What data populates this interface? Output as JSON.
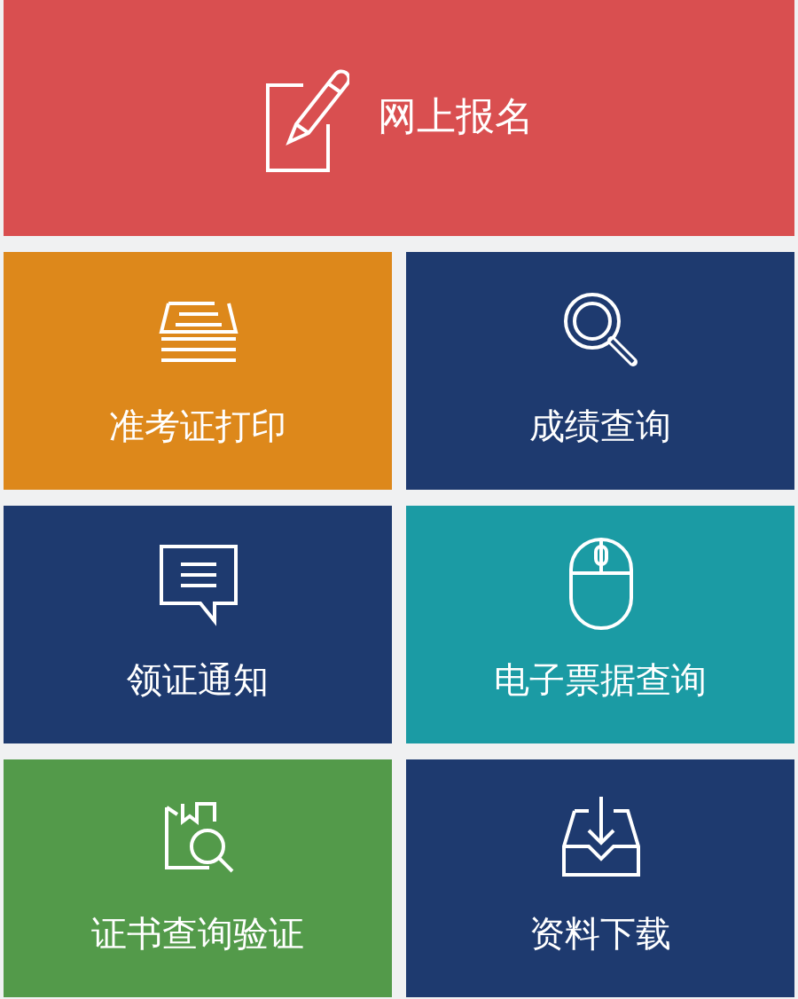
{
  "banner": {
    "label": "网上报名",
    "color": "#d94f50"
  },
  "tiles": [
    {
      "label": "准考证打印",
      "color": "#dd881b"
    },
    {
      "label": "成绩查询",
      "color": "#1e3a6f"
    },
    {
      "label": "领证通知",
      "color": "#1e3a6f"
    },
    {
      "label": "电子票据查询",
      "color": "#1b9ba4"
    },
    {
      "label": "证书查询验证",
      "color": "#539a4a"
    },
    {
      "label": "资料下载",
      "color": "#1e3a6f"
    }
  ]
}
